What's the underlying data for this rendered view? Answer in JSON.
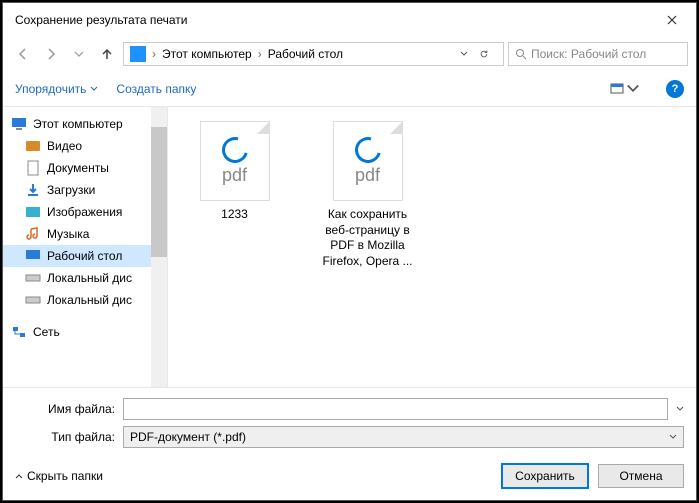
{
  "title": "Сохранение результата печати",
  "breadcrumbs": {
    "pc": "Этот компьютер",
    "desktop": "Рабочий стол"
  },
  "search": {
    "placeholder": "Поиск: Рабочий стол"
  },
  "toolbar": {
    "organize": "Упорядочить",
    "newfolder": "Создать папку"
  },
  "help": "?",
  "tree": {
    "root": "Этот компьютер",
    "items": [
      "Видео",
      "Документы",
      "Загрузки",
      "Изображения",
      "Музыка",
      "Рабочий стол",
      "Локальный дис",
      "Локальный дис"
    ],
    "network": "Сеть"
  },
  "files": [
    {
      "name": "1233",
      "ext": "pdf"
    },
    {
      "name": "Как сохранить веб-страницу в PDF в Mozilla Firefox, Opera ...",
      "ext": "pdf"
    }
  ],
  "form": {
    "name_label": "Имя файла:",
    "type_label": "Тип файла:",
    "type_value": "PDF-документ (*.pdf)",
    "name_value": ""
  },
  "footer": {
    "hide": "Скрыть папки",
    "save": "Сохранить",
    "cancel": "Отмена"
  }
}
